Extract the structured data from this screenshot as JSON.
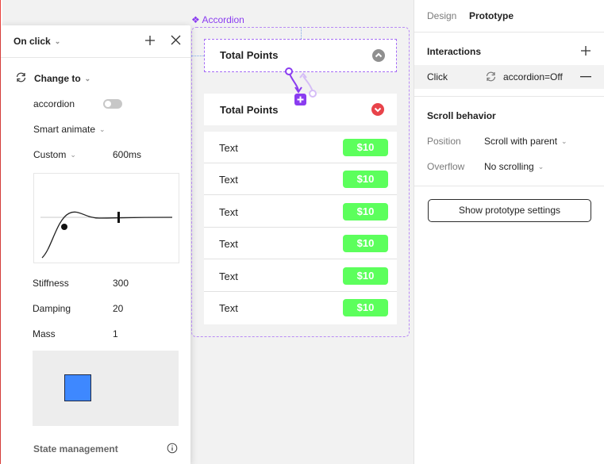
{
  "interaction_panel": {
    "trigger": "On click",
    "action": "Change to",
    "property_name": "accordion",
    "animation": "Smart animate",
    "curve": "Custom",
    "duration": "600ms",
    "stiffness_label": "Stiffness",
    "stiffness": "300",
    "damping_label": "Damping",
    "damping": "20",
    "mass_label": "Mass",
    "mass": "1",
    "state_management": "State management",
    "preview_color": "#3e88ff"
  },
  "canvas": {
    "component_label": "Accordion",
    "header_title": "Total Points",
    "header_title_2": "Total Points",
    "collapsed_icon_color": "#8f8f8f",
    "expanded_icon_color": "#e8434a",
    "rows": [
      {
        "text": "Text",
        "price": "$10"
      },
      {
        "text": "Text",
        "price": "$10"
      },
      {
        "text": "Text",
        "price": "$10"
      },
      {
        "text": "Text",
        "price": "$10"
      },
      {
        "text": "Text",
        "price": "$10"
      },
      {
        "text": "Text",
        "price": "$10"
      }
    ],
    "price_color": "#5cff5c",
    "accent": "#8a3cf0"
  },
  "right_panel": {
    "tabs": {
      "design": "Design",
      "prototype": "Prototype"
    },
    "interactions_title": "Interactions",
    "interaction_trigger": "Click",
    "interaction_target": "accordion=Off",
    "scroll_title": "Scroll behavior",
    "position_label": "Position",
    "position_value": "Scroll with parent",
    "overflow_label": "Overflow",
    "overflow_value": "No scrolling",
    "settings_button": "Show prototype settings"
  }
}
